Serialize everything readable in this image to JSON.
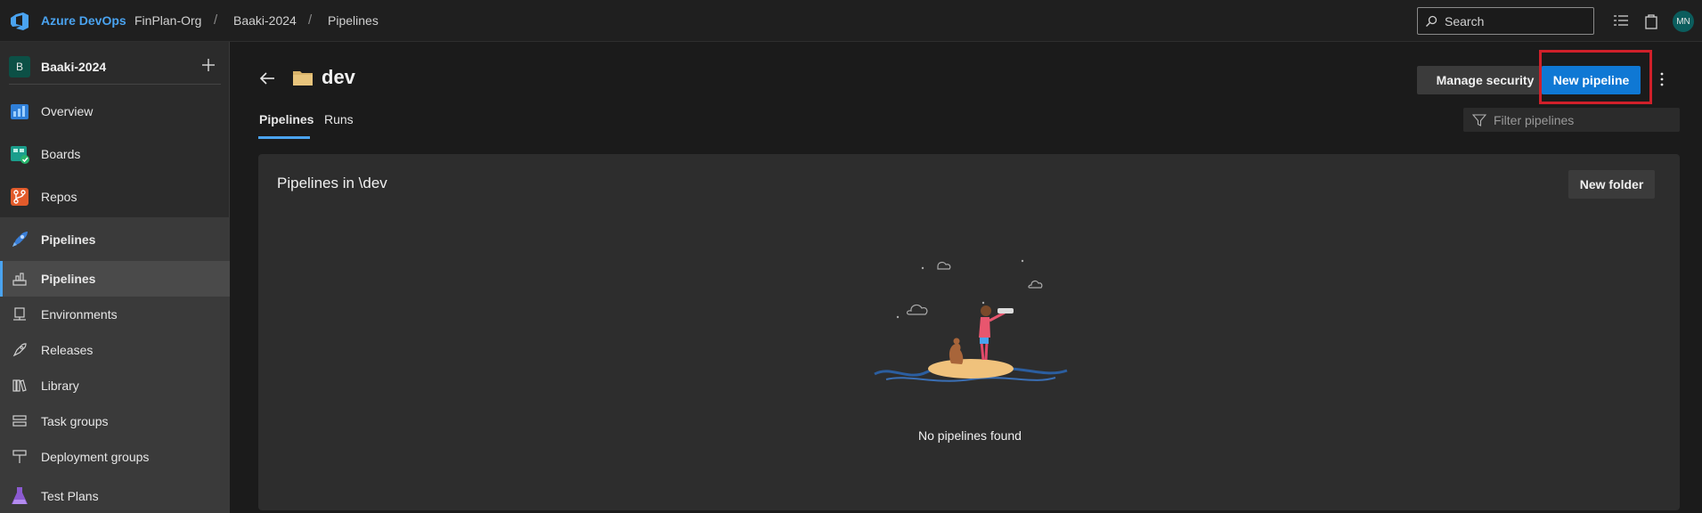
{
  "topbar": {
    "brand": "Azure DevOps",
    "org": "FinPlan-Org",
    "project": "Baaki-2024",
    "section": "Pipelines",
    "separator": "/",
    "search_label": "Search",
    "user_initials": "MN"
  },
  "sidebar": {
    "project_initial": "B",
    "project_name": "Baaki-2024",
    "items": [
      {
        "label": "Overview"
      },
      {
        "label": "Boards"
      },
      {
        "label": "Repos"
      },
      {
        "label": "Pipelines"
      },
      {
        "label": "Pipelines"
      },
      {
        "label": "Environments"
      },
      {
        "label": "Releases"
      },
      {
        "label": "Library"
      },
      {
        "label": "Task groups"
      },
      {
        "label": "Deployment groups"
      },
      {
        "label": "Test Plans"
      }
    ]
  },
  "main": {
    "title": "dev",
    "manage_security_label": "Manage security",
    "new_pipeline_label": "New pipeline",
    "tabs": [
      {
        "label": "Pipelines",
        "active": true
      },
      {
        "label": "Runs",
        "active": false
      }
    ],
    "filter_placeholder": "Filter pipelines",
    "card_title": "Pipelines in \\dev",
    "new_folder_label": "New folder",
    "empty_text": "No pipelines found"
  },
  "colors": {
    "accent": "#0f78d4",
    "brand_text": "#4aa3f0",
    "highlight": "#d0202a"
  }
}
